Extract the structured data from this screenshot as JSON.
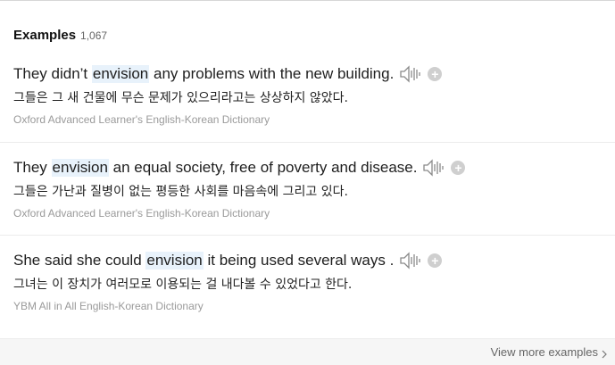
{
  "section": {
    "title": "Examples",
    "count": "1,067"
  },
  "examples": [
    {
      "before": "They didn’t ",
      "keyword": "envision",
      "after": " any problems with the new building.",
      "translation": "그들은 그 새 건물에 무슨 문제가 있으리라고는 상상하지 않았다.",
      "source": "Oxford Advanced Learner's English-Korean Dictionary",
      "icons": [
        "speaker-icon",
        "plus-icon"
      ]
    },
    {
      "before": "They ",
      "keyword": "envision",
      "after": " an equal society, free of poverty and disease.",
      "translation": "그들은 가난과 질병이 없는 평등한 사회를 마음속에 그리고 있다.",
      "source": "Oxford Advanced Learner's English-Korean Dictionary",
      "icons": [
        "speaker-icon",
        "plus-icon"
      ]
    },
    {
      "before": "She said she could ",
      "keyword": "envision",
      "after": " it being used several ways .",
      "translation": "그녀는 이 장치가 여러모로 이용되는 걸 내다볼 수 있었다고 한다.",
      "source": "YBM All in All English-Korean Dictionary",
      "icons": [
        "speaker-icon",
        "plus-icon"
      ]
    }
  ],
  "footer": {
    "view_more": "View more examples"
  },
  "colors": {
    "highlight": "#e8f2fb",
    "source_text": "#9a9a9a",
    "plus_button": "#cfcfcf",
    "footer_bg": "#f6f6f6"
  }
}
